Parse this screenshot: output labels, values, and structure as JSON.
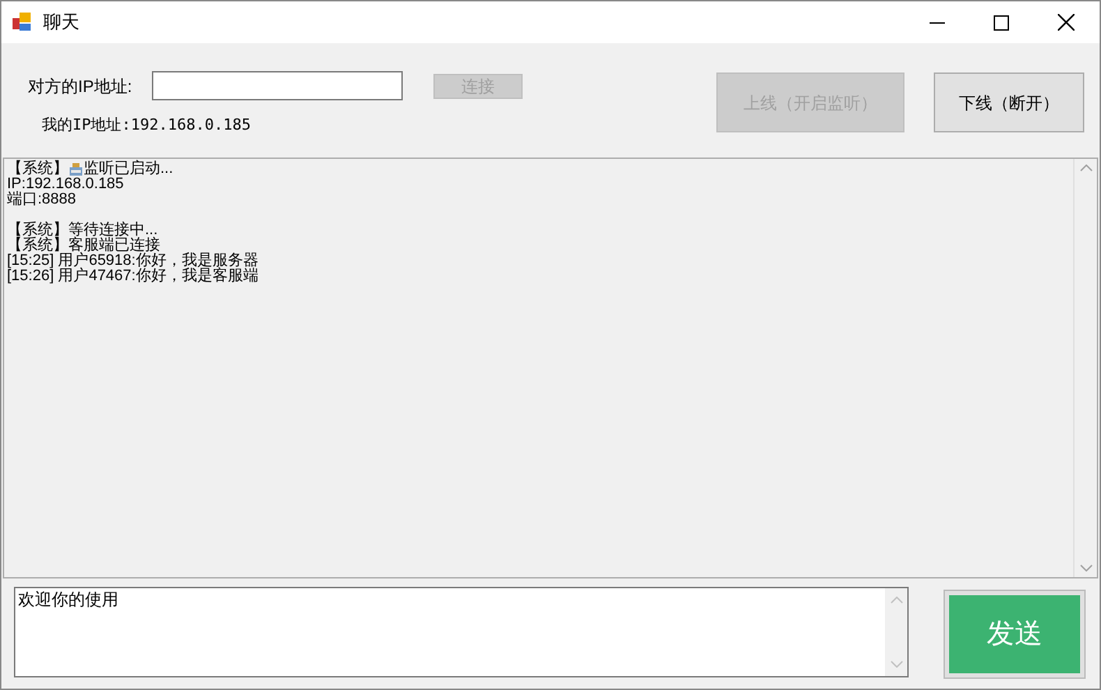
{
  "window": {
    "title": "聊天"
  },
  "connection": {
    "peer_ip_label": "对方的IP地址:",
    "connect_button": {
      "label": "连接",
      "disabled": true
    },
    "my_ip": "我的IP地址:192.168.0.185"
  },
  "buttons": [
    {
      "label": "上线（开启监听）",
      "disabled": true
    },
    {
      "label": "下线（断开）",
      "disabled": false
    }
  ],
  "log": [
    {
      "kind": "icon_text",
      "before": "【系统】",
      "after": "监听已启动..."
    },
    {
      "kind": "text",
      "text": "IP:192.168.0.185"
    },
    {
      "kind": "text",
      "text": "端口:8888"
    },
    {
      "kind": "blank"
    },
    {
      "kind": "text",
      "text": "【系统】等待连接中..."
    },
    {
      "kind": "text",
      "text": "【系统】客服端已连接"
    },
    {
      "kind": "text",
      "text": "[15:25] 用户65918:你好，我是服务器"
    },
    {
      "kind": "text",
      "text": "[15:26] 用户47467:你好，我是客服端"
    }
  ],
  "message": {
    "value": "欢迎你的使用"
  },
  "send_button": {
    "label": "发送"
  }
}
